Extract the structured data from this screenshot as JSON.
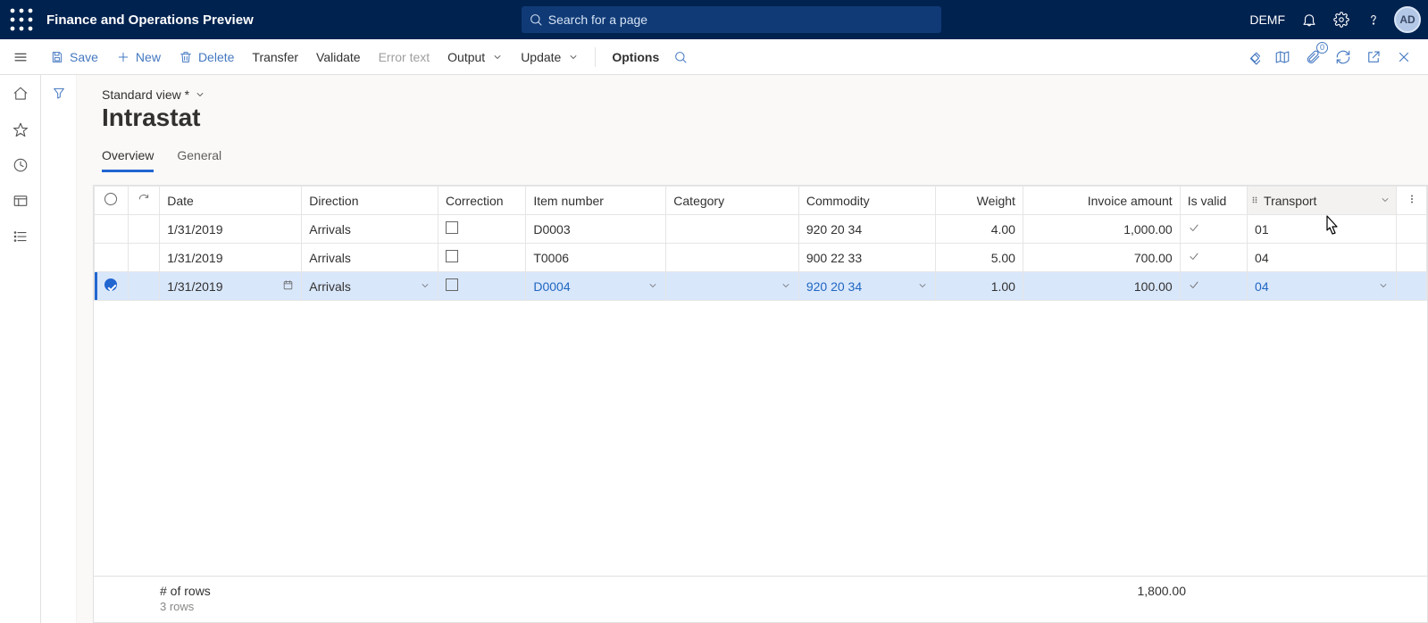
{
  "header": {
    "app_title": "Finance and Operations Preview",
    "search_placeholder": "Search for a page",
    "company": "DEMF",
    "avatar": "AD"
  },
  "actions": {
    "save": "Save",
    "new": "New",
    "delete": "Delete",
    "transfer": "Transfer",
    "validate": "Validate",
    "error_text": "Error text",
    "output": "Output",
    "update": "Update",
    "options": "Options",
    "badge_count": "0"
  },
  "page": {
    "view_label": "Standard view *",
    "title": "Intrastat",
    "tabs": [
      "Overview",
      "General"
    ],
    "active_tab_index": 0
  },
  "grid": {
    "columns": [
      "Date",
      "Direction",
      "Correction",
      "Item number",
      "Category",
      "Commodity",
      "Weight",
      "Invoice amount",
      "Is valid",
      "Transport"
    ],
    "rows": [
      {
        "date": "1/31/2019",
        "direction": "Arrivals",
        "correction": false,
        "item": "D0003",
        "category": "",
        "commodity": "920 20 34",
        "weight": "4.00",
        "invoice": "1,000.00",
        "valid": true,
        "transport": "01",
        "selected": false
      },
      {
        "date": "1/31/2019",
        "direction": "Arrivals",
        "correction": false,
        "item": "T0006",
        "category": "",
        "commodity": "900 22 33",
        "weight": "5.00",
        "invoice": "700.00",
        "valid": true,
        "transport": "04",
        "selected": false
      },
      {
        "date": "1/31/2019",
        "direction": "Arrivals",
        "correction": false,
        "item": "D0004",
        "category": "",
        "commodity": "920 20 34",
        "weight": "1.00",
        "invoice": "100.00",
        "valid": true,
        "transport": "04",
        "selected": true
      }
    ],
    "footer": {
      "label": "# of rows",
      "count": "3 rows",
      "total": "1,800.00"
    }
  }
}
